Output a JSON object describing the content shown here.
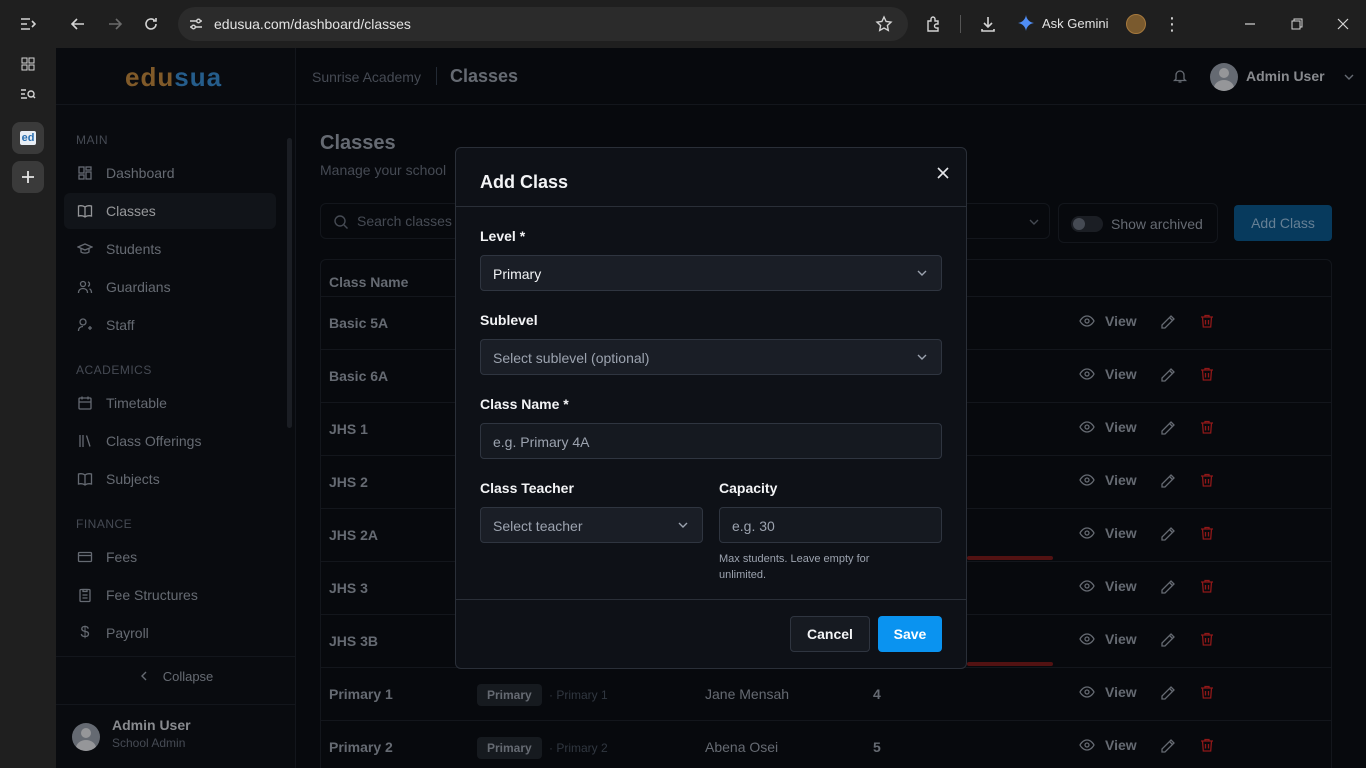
{
  "browser": {
    "url": "edusua.com/dashboard/classes",
    "gemini_label": "Ask Gemini",
    "side_tab_label": "ed"
  },
  "sidebar": {
    "logo_part1": "edu",
    "logo_part2": "sua",
    "sections": {
      "main": "MAIN",
      "academics": "ACADEMICS",
      "finance": "FINANCE"
    },
    "items": [
      {
        "label": "Dashboard",
        "icon": "grid-icon"
      },
      {
        "label": "Classes",
        "icon": "book-icon",
        "active": true
      },
      {
        "label": "Students",
        "icon": "graduation-cap-icon"
      },
      {
        "label": "Guardians",
        "icon": "users-icon"
      },
      {
        "label": "Staff",
        "icon": "staff-icon"
      },
      {
        "label": "Timetable",
        "icon": "calendar-icon"
      },
      {
        "label": "Class Offerings",
        "icon": "library-icon"
      },
      {
        "label": "Subjects",
        "icon": "book-open-icon"
      },
      {
        "label": "Fees",
        "icon": "wallet-icon"
      },
      {
        "label": "Fee Structures",
        "icon": "clipboard-icon"
      },
      {
        "label": "Payroll",
        "icon": "dollar-icon"
      }
    ],
    "collapse_label": "Collapse",
    "user_name": "Admin User",
    "user_role": "School Admin"
  },
  "header": {
    "school": "Sunrise Academy",
    "page": "Classes",
    "user_name": "Admin User"
  },
  "main": {
    "title": "Classes",
    "subtitle": "Manage your school c",
    "search_placeholder": "Search classes",
    "show_archived": "Show archived",
    "add_button": "Add Class",
    "column_class_name": "Class Name",
    "view_label": "View",
    "rows": [
      {
        "name": "Basic 5A",
        "level": "",
        "sublevel": "",
        "teacher": "",
        "count": ""
      },
      {
        "name": "Basic 6A",
        "level": "",
        "sublevel": "",
        "teacher": "",
        "count": ""
      },
      {
        "name": "JHS 1",
        "level": "",
        "sublevel": "",
        "teacher": "",
        "count": ""
      },
      {
        "name": "JHS 2",
        "level": "",
        "sublevel": "",
        "teacher": "",
        "count": ""
      },
      {
        "name": "JHS 2A",
        "level": "",
        "sublevel": "",
        "teacher": "",
        "count": ""
      },
      {
        "name": "JHS 3",
        "level": "",
        "sublevel": "",
        "teacher": "",
        "count": ""
      },
      {
        "name": "JHS 3B",
        "level": "",
        "sublevel": "",
        "teacher": "",
        "count": ""
      },
      {
        "name": "Primary 1",
        "level": "Primary",
        "sublevel": "· Primary 1",
        "teacher": "Jane Mensah",
        "count": "4"
      },
      {
        "name": "Primary 2",
        "level": "Primary",
        "sublevel": "· Primary 2",
        "teacher": "Abena Osei",
        "count": "5"
      }
    ]
  },
  "modal": {
    "title": "Add Class",
    "level_label": "Level *",
    "level_value": "Primary",
    "sublevel_label": "Sublevel",
    "sublevel_placeholder": "Select sublevel (optional)",
    "class_name_label": "Class Name *",
    "class_name_placeholder": "e.g. Primary 4A",
    "teacher_label": "Class Teacher",
    "teacher_placeholder": "Select teacher",
    "capacity_label": "Capacity",
    "capacity_placeholder": "e.g. 30",
    "capacity_hint": "Max students. Leave empty for unlimited.",
    "cancel": "Cancel",
    "save": "Save"
  },
  "colors": {
    "primary_button": "#0a93f0",
    "add_button_dimmed": "#0b5a8f",
    "delete_icon": "#dc2626"
  }
}
